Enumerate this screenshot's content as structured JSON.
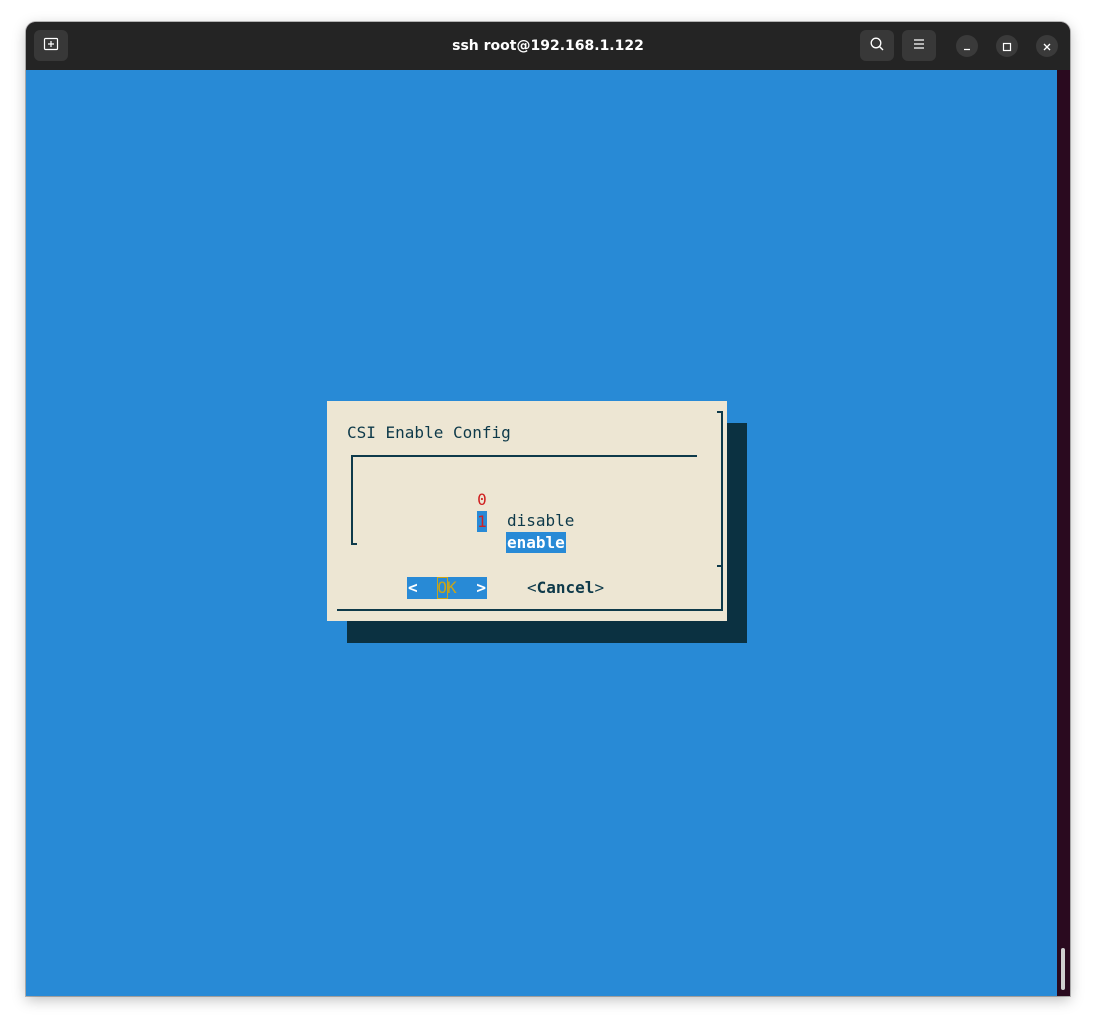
{
  "window": {
    "title": "ssh root@192.168.1.122",
    "buttons": {
      "new_tab_icon": "new-tab-icon",
      "search_icon": "search-icon",
      "menu_icon": "hamburger-menu-icon",
      "minimize_icon": "minimize-icon",
      "maximize_icon": "maximize-icon",
      "close_icon": "close-icon"
    }
  },
  "terminal": {
    "background": "#288ad6"
  },
  "dialog": {
    "title": "CSI Enable Config",
    "items": [
      {
        "tag": "0",
        "label": "disable",
        "selected": false
      },
      {
        "tag": "1",
        "label": "enable",
        "selected": true
      }
    ],
    "ok_left": "<",
    "ok_label": "OK",
    "ok_right": ">",
    "cancel_left": "<",
    "cancel_label": "Cancel",
    "cancel_right": ">",
    "colors": {
      "background": "#ede6d3",
      "highlight": "#288ad6",
      "tag": "#d02020",
      "text": "#0e3a4a",
      "shadow": "#0b3141"
    }
  }
}
